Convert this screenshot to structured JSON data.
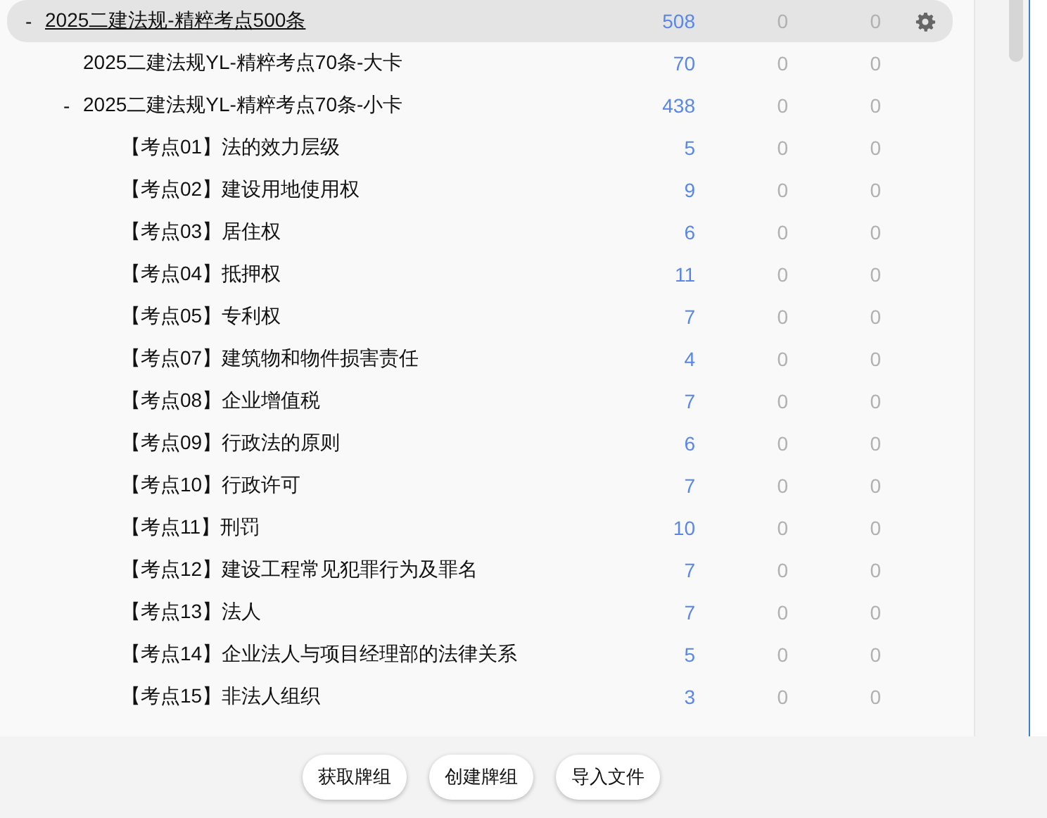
{
  "decks": [
    {
      "name": "2025二建法规-精粹考点500条",
      "toggle": "-",
      "due": "508",
      "new": "0",
      "review": "0",
      "selected": true,
      "children": [
        {
          "name": "2025二建法规YL-精粹考点70条-大卡",
          "due": "70",
          "new": "0",
          "review": "0",
          "selected": false
        },
        {
          "name": "2025二建法规YL-精粹考点70条-小卡",
          "toggle": "-",
          "due": "438",
          "new": "0",
          "review": "0",
          "selected": false,
          "children": [
            {
              "name": "【考点01】法的效力层级",
              "due": "5",
              "new": "0",
              "review": "0",
              "selected": false
            },
            {
              "name": "【考点02】建设用地使用权",
              "due": "9",
              "new": "0",
              "review": "0",
              "selected": false
            },
            {
              "name": "【考点03】居住权",
              "due": "6",
              "new": "0",
              "review": "0",
              "selected": false
            },
            {
              "name": "【考点04】抵押权",
              "due": "11",
              "new": "0",
              "review": "0",
              "selected": false
            },
            {
              "name": "【考点05】专利权",
              "due": "7",
              "new": "0",
              "review": "0",
              "selected": false
            },
            {
              "name": "【考点07】建筑物和物件损害责任",
              "due": "4",
              "new": "0",
              "review": "0",
              "selected": false
            },
            {
              "name": "【考点08】企业增值税",
              "due": "7",
              "new": "0",
              "review": "0",
              "selected": false
            },
            {
              "name": "【考点09】行政法的原则",
              "due": "6",
              "new": "0",
              "review": "0",
              "selected": false
            },
            {
              "name": "【考点10】行政许可",
              "due": "7",
              "new": "0",
              "review": "0",
              "selected": false
            },
            {
              "name": "【考点11】刑罚",
              "due": "10",
              "new": "0",
              "review": "0",
              "selected": false
            },
            {
              "name": "【考点12】建设工程常见犯罪行为及罪名",
              "due": "7",
              "new": "0",
              "review": "0",
              "selected": false
            },
            {
              "name": "【考点13】法人",
              "due": "7",
              "new": "0",
              "review": "0",
              "selected": false
            },
            {
              "name": "【考点14】企业法人与项目经理部的法律关系",
              "due": "5",
              "new": "0",
              "review": "0",
              "selected": false
            },
            {
              "name": "【考点15】非法人组织",
              "due": "3",
              "new": "0",
              "review": "0",
              "selected": false
            }
          ]
        }
      ]
    }
  ],
  "buttons": [
    "获取牌组",
    "创建牌组",
    "导入文件"
  ]
}
